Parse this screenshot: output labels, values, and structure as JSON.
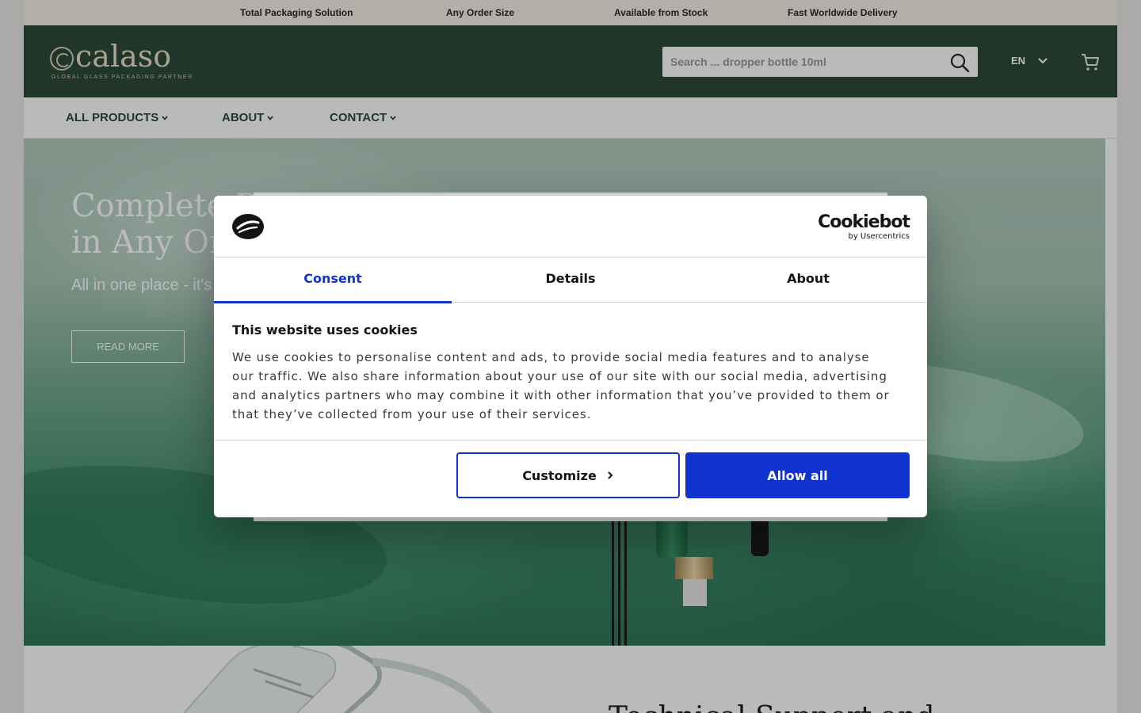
{
  "usp_bar": {
    "items": [
      "Total Packaging Solution",
      "Any Order Size",
      "Available from Stock",
      "Fast Worldwide Delivery"
    ]
  },
  "header": {
    "logo_text": "calaso",
    "logo_tagline": "GLOBAL GLASS PACKAGING PARTNER",
    "search_placeholder": "Search ... dropper bottle 10ml",
    "language": "EN",
    "icons": [
      "search-icon",
      "chevron-down-icon",
      "cart-icon"
    ]
  },
  "nav": {
    "items": [
      {
        "label": "ALL PRODUCTS"
      },
      {
        "label": "ABOUT"
      },
      {
        "label": "CONTACT"
      }
    ]
  },
  "hero": {
    "title_line1": "Complete P",
    "title_line2": "in Any Ord",
    "subtitle": "All in one place - it's",
    "button_label": "READ MORE"
  },
  "section2": {
    "title": "Technical Support and"
  },
  "cookie_dialog": {
    "brand_name": "Cookiebot",
    "brand_sub": "by Usercentrics",
    "tabs": [
      {
        "label": "Consent",
        "active": true
      },
      {
        "label": "Details",
        "active": false
      },
      {
        "label": "About",
        "active": false
      }
    ],
    "title": "This website uses cookies",
    "body": "We use cookies to personalise content and ads, to provide social media features and to analyse our traffic. We also share information about your use of our site with our social media, advertising and analytics partners who may combine it with other information that you’ve provided to them or that they’ve collected from your use of their services.",
    "customize_label": "Customize",
    "allow_label": "Allow all"
  },
  "colors": {
    "header_green": "#2d4b3c",
    "accent_blue": "#1032cf",
    "usp_bar_bg": "#f3f0e6"
  }
}
